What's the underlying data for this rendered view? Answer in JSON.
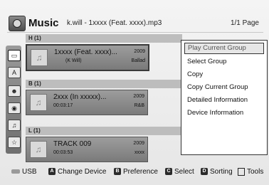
{
  "header": {
    "app_title": "Music",
    "file_name": "k.will - 1xxxx (Feat. xxxx).mp3",
    "page_count": "1/1 Page"
  },
  "groups": [
    {
      "label": "H  (1)",
      "item": {
        "title": "1xxxx (Feat. xxxx)...",
        "sub": "(K Will)",
        "year": "2009",
        "genre": "Ballad"
      }
    },
    {
      "label": "B  (1)",
      "item": {
        "title": "2xxx (In xxxxx)...",
        "sub": "00:03:17",
        "year": "2009",
        "genre": "R&B"
      }
    },
    {
      "label": "L  (1)",
      "item": {
        "title": "TRACK 009",
        "sub": "00:03:53",
        "year": "2009",
        "genre": "xxxx"
      }
    }
  ],
  "tools_menu": {
    "items": [
      "Play Current Group",
      "Select Group",
      "Copy",
      "Copy Current Group",
      "Detailed Information",
      "Device Information"
    ]
  },
  "footer": {
    "usb": "USB",
    "a_key": "A",
    "a_label": "Change Device",
    "b_key": "B",
    "b_label": "Preference",
    "c_key": "C",
    "c_label": "Select",
    "d_key": "D",
    "d_label": "Sorting",
    "tools_label": "Tools"
  },
  "icons": {
    "app": "music-icon",
    "thumb": "music-note-icon",
    "sidebar": [
      "folder-icon",
      "abc-icon",
      "artist-icon",
      "album-icon",
      "genre-icon",
      "favorite-icon"
    ],
    "footer": [
      "usb-icon",
      "tools-icon"
    ]
  }
}
